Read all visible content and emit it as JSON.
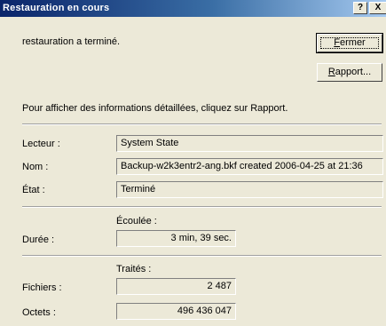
{
  "window": {
    "title": "Restauration en cours",
    "help": "?",
    "close": "X"
  },
  "status_text": "restauration a terminé.",
  "buttons": {
    "close_prefix": "",
    "close_mn": "F",
    "close_rest": "ermer",
    "report_prefix": "",
    "report_mn": "R",
    "report_rest": "apport..."
  },
  "info_text": "Pour afficher des informations détaillées, cliquez sur Rapport.",
  "details": {
    "drive_label": "Lecteur :",
    "drive_value": "System State",
    "name_label": "Nom :",
    "name_value": "Backup-w2k3entr2-ang.bkf created 2006-04-25 at 21:36",
    "state_label": "État :",
    "state_value": "Terminé"
  },
  "duration": {
    "header": "Écoulée :",
    "label": "Durée :",
    "value": "3 min, 39 sec."
  },
  "counts": {
    "header": "Traités :",
    "files_label": "Fichiers :",
    "files_value": "2 487",
    "bytes_label": "Octets :",
    "bytes_value": "496 436 047"
  }
}
